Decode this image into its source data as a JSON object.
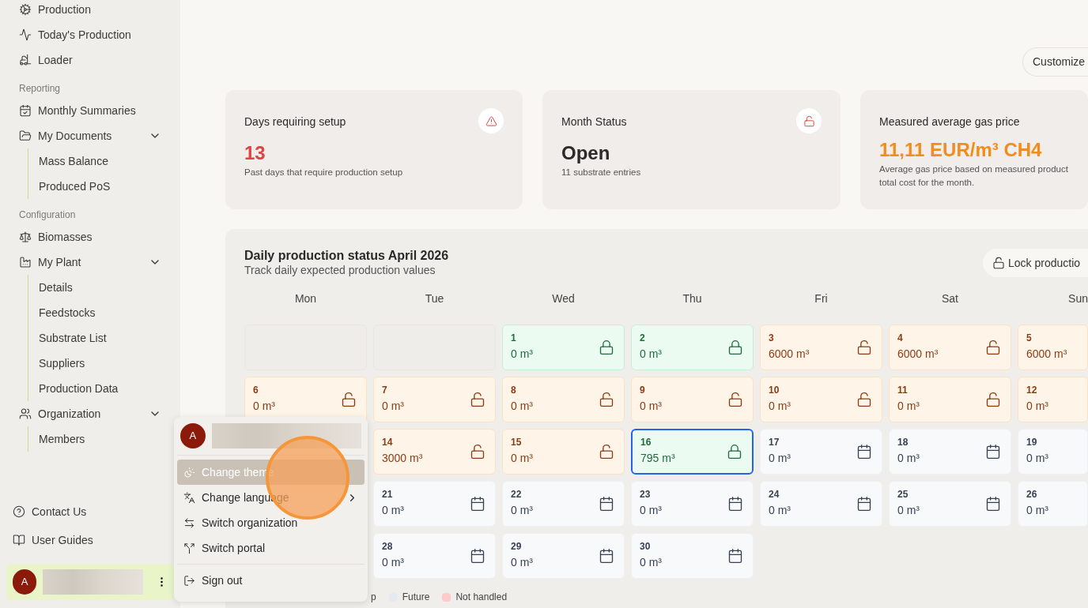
{
  "sidebar": {
    "nav": [
      {
        "kind": "item",
        "label": "Production"
      },
      {
        "kind": "item",
        "label": "Today's Production"
      },
      {
        "kind": "item",
        "label": "Loader"
      },
      {
        "kind": "heading",
        "label": "Reporting"
      },
      {
        "kind": "item",
        "label": "Monthly Summaries"
      },
      {
        "kind": "group",
        "label": "My Documents",
        "expanded": true,
        "children": [
          {
            "label": "Mass Balance"
          },
          {
            "label": "Produced PoS"
          }
        ]
      },
      {
        "kind": "heading",
        "label": "Configuration"
      },
      {
        "kind": "item",
        "label": "Biomasses"
      },
      {
        "kind": "group",
        "label": "My Plant",
        "expanded": true,
        "children": [
          {
            "label": "Details"
          },
          {
            "label": "Feedstocks"
          },
          {
            "label": "Substrate List"
          },
          {
            "label": "Suppliers"
          },
          {
            "label": "Production Data"
          }
        ]
      },
      {
        "kind": "group",
        "label": "Organization",
        "expanded": true,
        "children": [
          {
            "label": "Members"
          }
        ]
      }
    ],
    "footer_links": [
      {
        "label": "Contact Us"
      },
      {
        "label": "User Guides"
      }
    ],
    "user": {
      "avatar": "A"
    }
  },
  "toolbar": {
    "customize_button": "Customize"
  },
  "cards": [
    {
      "title": "Days requiring setup",
      "value": "13",
      "kind": "alert",
      "description": "Past days that require production setup"
    },
    {
      "title": "Month Status",
      "value": "Open",
      "kind": "neutral",
      "description": "11 substrate entries"
    },
    {
      "title": "Measured average gas price",
      "value": "11,11 EUR/m³ CH4",
      "kind": "price",
      "description": "Average gas price based on measured product",
      "description_2": "total cost for the month."
    }
  ],
  "calendar": {
    "title": "Daily production status April 2026",
    "subtitle": "Track daily expected production values",
    "lock_button": "Lock productio",
    "weekdays": [
      "Mon",
      "Tue",
      "Wed",
      "Thu",
      "Fri",
      "Sat",
      "Sun"
    ],
    "days": [
      {
        "kind": "empty"
      },
      {
        "kind": "empty"
      },
      {
        "day": "1",
        "value": "0 m³",
        "kind": "locked",
        "selected": false
      },
      {
        "day": "2",
        "value": "0 m³",
        "kind": "locked",
        "selected": false
      },
      {
        "day": "3",
        "value": "6000 m³",
        "kind": "open",
        "selected": false
      },
      {
        "day": "4",
        "value": "6000 m³",
        "kind": "open",
        "selected": false
      },
      {
        "day": "5",
        "value": "6000 m³",
        "kind": "open",
        "selected": false
      },
      {
        "day": "6",
        "value": "0 m³",
        "kind": "open",
        "selected": false
      },
      {
        "day": "7",
        "value": "0 m³",
        "kind": "open",
        "selected": false
      },
      {
        "day": "8",
        "value": "0 m³",
        "kind": "open",
        "selected": false
      },
      {
        "day": "9",
        "value": "0 m³",
        "kind": "open",
        "selected": false
      },
      {
        "day": "10",
        "value": "0 m³",
        "kind": "open",
        "selected": false
      },
      {
        "day": "11",
        "value": "0 m³",
        "kind": "open",
        "selected": false
      },
      {
        "day": "12",
        "value": "0 m³",
        "kind": "open",
        "selected": false
      },
      {
        "kind": "hidden"
      },
      {
        "day": "14",
        "value": "3000 m³",
        "kind": "open",
        "selected": false
      },
      {
        "day": "15",
        "value": "0 m³",
        "kind": "open",
        "selected": false
      },
      {
        "day": "16",
        "value": "795 m³",
        "kind": "locked",
        "selected": true
      },
      {
        "day": "17",
        "value": "0 m³",
        "kind": "future",
        "selected": false
      },
      {
        "day": "18",
        "value": "0 m³",
        "kind": "future",
        "selected": false
      },
      {
        "day": "19",
        "value": "0 m³",
        "kind": "future",
        "selected": false
      },
      {
        "kind": "hidden"
      },
      {
        "day": "21",
        "value": "0 m³",
        "kind": "future",
        "selected": false
      },
      {
        "day": "22",
        "value": "0 m³",
        "kind": "future",
        "selected": false
      },
      {
        "day": "23",
        "value": "0 m³",
        "kind": "future",
        "selected": false
      },
      {
        "day": "24",
        "value": "0 m³",
        "kind": "future",
        "selected": false
      },
      {
        "day": "25",
        "value": "0 m³",
        "kind": "future",
        "selected": false
      },
      {
        "day": "26",
        "value": "0 m³",
        "kind": "future",
        "selected": false
      },
      {
        "kind": "hidden"
      },
      {
        "day": "28",
        "value": "0 m³",
        "kind": "future",
        "selected": false
      },
      {
        "day": "29",
        "value": "0 m³",
        "kind": "future",
        "selected": false
      },
      {
        "day": "30",
        "value": "0 m³",
        "kind": "future",
        "selected": false
      }
    ],
    "legend_fragment": "p",
    "legend": [
      {
        "label": "Future",
        "color": "#e5e9f0"
      },
      {
        "label": "Not handled",
        "color": "#fecaca"
      }
    ]
  },
  "user_menu": {
    "avatar": "A",
    "items": [
      {
        "kind": "item",
        "label": "Change theme",
        "selected": true
      },
      {
        "kind": "submenu",
        "label": "Change language",
        "selected": false
      },
      {
        "kind": "item",
        "label": "Switch organization",
        "selected": false
      },
      {
        "kind": "item",
        "label": "Switch portal",
        "selected": false
      },
      {
        "kind": "separator"
      },
      {
        "kind": "item",
        "label": "Sign out",
        "selected": false
      }
    ]
  }
}
